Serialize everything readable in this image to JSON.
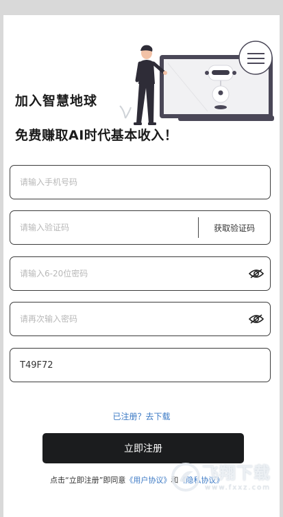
{
  "hero": {
    "title_line1": "加入智慧地球",
    "title_line2": "免费赚取AI时代基本收入！"
  },
  "form": {
    "phone_placeholder": "请输入手机号码",
    "code_placeholder": "请输入验证码",
    "get_code_label": "获取验证码",
    "password_placeholder": "请输入6-20位密码",
    "confirm_placeholder": "请再次输入密码",
    "invite_code_value": "T49F72"
  },
  "links": {
    "login_link": "已注册？去下载"
  },
  "buttons": {
    "register_label": "立即注册"
  },
  "agreement": {
    "prefix": "点击“立即注册”即同意",
    "user_agreement": "《用户协议》",
    "and": "和",
    "privacy_policy": "《隐私协议》"
  },
  "watermark": {
    "brand": "飞翔下载",
    "domain": "www.fxxz.com"
  },
  "icons": {
    "password_toggle": "eye-slash-icon",
    "confirm_toggle": "eye-slash-icon",
    "chat": "speech-bubble-icon"
  },
  "colors": {
    "button_bg": "#1b1c1e",
    "link": "#3a78c4",
    "border": "#3a3a3a"
  }
}
